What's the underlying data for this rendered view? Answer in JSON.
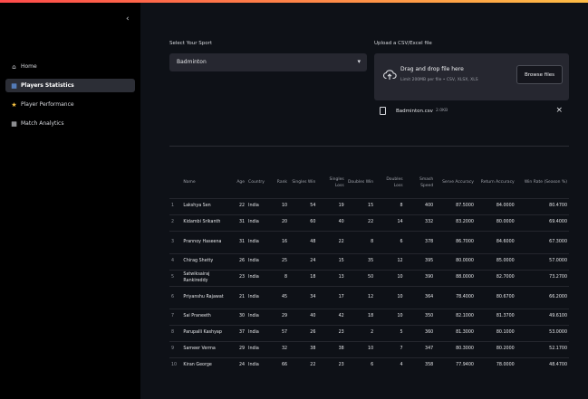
{
  "sidebar": {
    "collapse_icon": "chevron-left-icon",
    "items": [
      {
        "label": "Home",
        "icon": "home-icon",
        "active": false
      },
      {
        "label": "Players Statistics",
        "icon": "chart-icon",
        "active": true
      },
      {
        "label": "Player Performance",
        "icon": "trophy-icon",
        "active": false
      },
      {
        "label": "Match Analytics",
        "icon": "table-icon",
        "active": false
      }
    ]
  },
  "sport": {
    "label": "Select Your Sport",
    "value": "Badminton"
  },
  "upload": {
    "label": "Upload a CSV/Excel file",
    "drag_text": "Drag and drop file here",
    "limit_text": "Limit 200MB per file • CSV, XLSX, XLS",
    "browse_label": "Browse files",
    "file_name": "Badminton.csv",
    "file_size": "2.0KB"
  },
  "table": {
    "columns": [
      "",
      "Name",
      "Age",
      "Country",
      "Rank",
      "Singles Win",
      "Singles Loss",
      "Doubles Win",
      "Doubles Loss",
      "Smash Speed",
      "Serve Accuracy",
      "Return Accuracy",
      "Win Rate (Season %)"
    ],
    "rows": [
      [
        "1",
        "Lakshya Sen",
        "22",
        "India",
        "10",
        "54",
        "19",
        "15",
        "8",
        "400",
        "87.5000",
        "84.0000",
        "80.4700"
      ],
      [
        "2",
        "Kidambi Srikanth",
        "31",
        "India",
        "20",
        "60",
        "40",
        "22",
        "14",
        "332",
        "83.2000",
        "80.0000",
        "69.4000"
      ],
      [
        "3",
        "Prannoy Haseena",
        "31",
        "India",
        "16",
        "48",
        "22",
        "8",
        "6",
        "378",
        "86.7000",
        "84.6000",
        "67.3000"
      ],
      [
        "4",
        "Chirag Shetty",
        "26",
        "India",
        "25",
        "24",
        "15",
        "35",
        "12",
        "395",
        "80.0000",
        "85.0000",
        "57.0000"
      ],
      [
        "5",
        "Satwiksairaj Rankireddy",
        "23",
        "India",
        "8",
        "18",
        "13",
        "50",
        "10",
        "390",
        "88.0000",
        "82.7000",
        "73.2700"
      ],
      [
        "6",
        "Priyanshu Rajawat",
        "21",
        "India",
        "45",
        "34",
        "17",
        "12",
        "10",
        "364",
        "78.4000",
        "80.6700",
        "66.2000"
      ],
      [
        "7",
        "Sai Praneeth",
        "30",
        "India",
        "29",
        "40",
        "42",
        "18",
        "10",
        "350",
        "82.1000",
        "81.3700",
        "49.6100"
      ],
      [
        "8",
        "Parupalli Kashyap",
        "37",
        "India",
        "57",
        "26",
        "23",
        "2",
        "5",
        "360",
        "81.3000",
        "80.1000",
        "53.0000"
      ],
      [
        "9",
        "Sameer Verma",
        "29",
        "India",
        "32",
        "38",
        "38",
        "10",
        "7",
        "347",
        "80.3000",
        "80.2000",
        "52.1700"
      ],
      [
        "10",
        "Kiran George",
        "24",
        "India",
        "66",
        "22",
        "23",
        "6",
        "4",
        "358",
        "77.9400",
        "78.0000",
        "48.4700"
      ]
    ]
  }
}
